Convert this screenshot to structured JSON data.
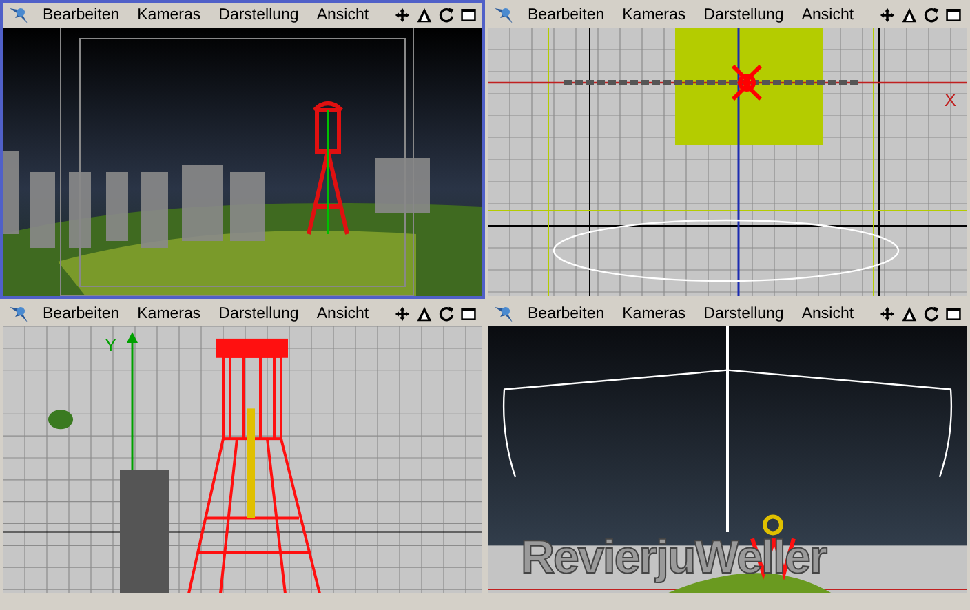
{
  "viewports": [
    {
      "kind": "perspective",
      "active": true,
      "menu": [
        "Bearbeiten",
        "Kameras",
        "Darstellung",
        "Ansicht"
      ]
    },
    {
      "kind": "top",
      "active": false,
      "menu": [
        "Bearbeiten",
        "Kameras",
        "Darstellung",
        "Ansicht"
      ],
      "axis_label": "X"
    },
    {
      "kind": "front",
      "active": false,
      "menu": [
        "Bearbeiten",
        "Kameras",
        "Darstellung",
        "Ansicht"
      ],
      "axis_label": "Y"
    },
    {
      "kind": "render",
      "active": false,
      "menu": [
        "Bearbeiten",
        "Kameras",
        "Darstellung",
        "Ansicht"
      ],
      "scene_text": "RevierjuWeller"
    }
  ]
}
